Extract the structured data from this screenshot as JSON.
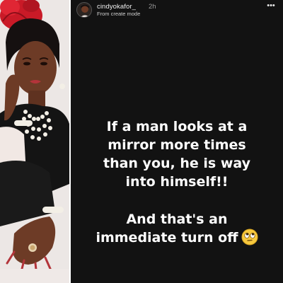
{
  "photo": {
    "description_icon": "woman-portrait",
    "colors": {
      "background": "#ece7e5",
      "dress": "#141414",
      "fascinator": "#d01d2a",
      "skin": "#6a3a25",
      "pearls": "#f3efe6"
    }
  },
  "story": {
    "background_color": "#121212",
    "header": {
      "username": "cindyokafor_",
      "timestamp": "2h",
      "subtitle": "From create mode",
      "more_icon": "more-horizontal-icon",
      "more_label": "•••"
    },
    "text": {
      "line1": "If a man looks at a",
      "line2": "mirror more times",
      "line3": "than you, he is way",
      "line4": "into himself!!",
      "line5": "And that's an",
      "line6": "immediate turn off",
      "emoji_icon": "face-with-rolling-eyes-icon"
    }
  }
}
